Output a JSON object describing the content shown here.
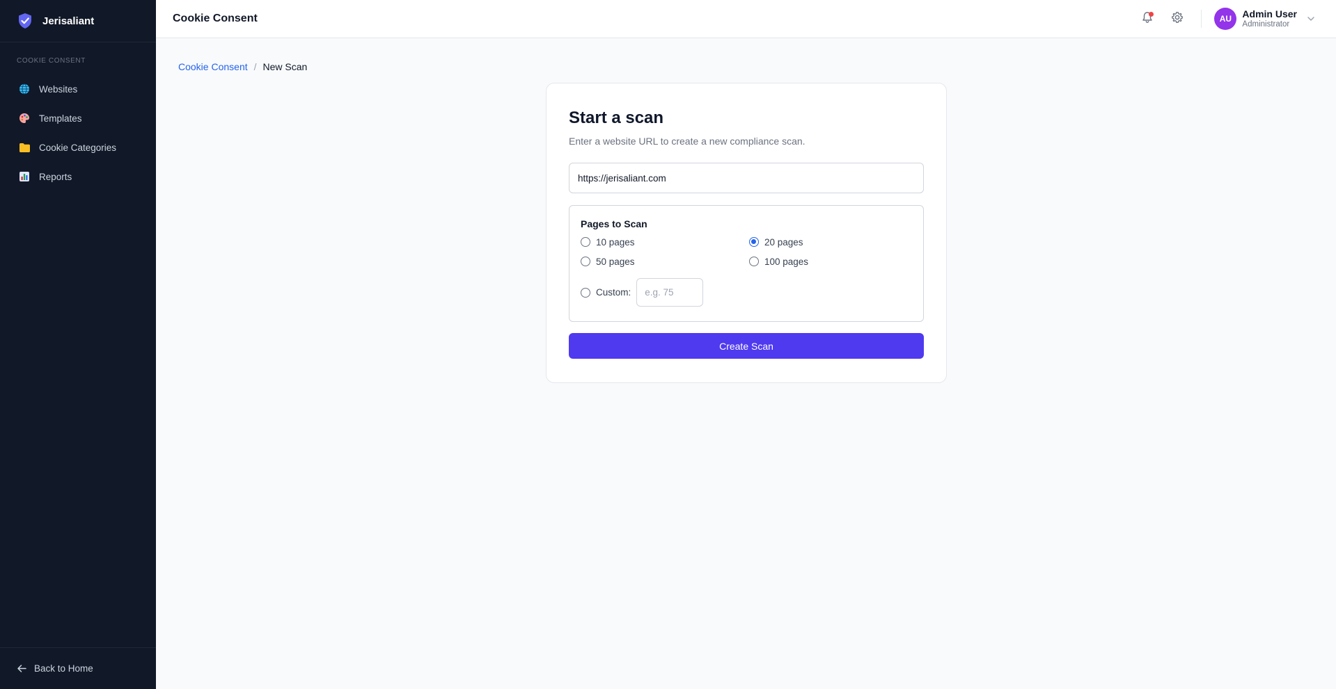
{
  "sidebar": {
    "brand": "Jerisaliant",
    "section_label": "COOKIE CONSENT",
    "items": [
      {
        "label": "Websites",
        "icon": "globe-icon"
      },
      {
        "label": "Templates",
        "icon": "palette-icon"
      },
      {
        "label": "Cookie Categories",
        "icon": "folder-icon"
      },
      {
        "label": "Reports",
        "icon": "bar-chart-icon"
      }
    ],
    "footer_label": "Back to Home"
  },
  "header": {
    "title": "Cookie Consent",
    "user_initials": "AU",
    "user_name": "Admin User",
    "user_role": "Administrator"
  },
  "breadcrumb": {
    "parent": "Cookie Consent",
    "separator": "/",
    "current": "New Scan"
  },
  "card": {
    "title": "Start a scan",
    "subtitle": "Enter a website URL to create a new compliance scan.",
    "url_value": "https://jerisaliant.com",
    "pages_title": "Pages to Scan",
    "options": [
      {
        "label": "10 pages",
        "checked": false
      },
      {
        "label": "20 pages",
        "checked": true
      },
      {
        "label": "50 pages",
        "checked": false
      },
      {
        "label": "100 pages",
        "checked": false
      }
    ],
    "custom_label": "Custom:",
    "custom_placeholder": "e.g. 75",
    "create_label": "Create Scan"
  },
  "colors": {
    "sidebar_bg": "#111827",
    "accent": "#4f3af0",
    "link": "#2563eb",
    "avatar": "#9333ea",
    "notification": "#ef4444"
  }
}
